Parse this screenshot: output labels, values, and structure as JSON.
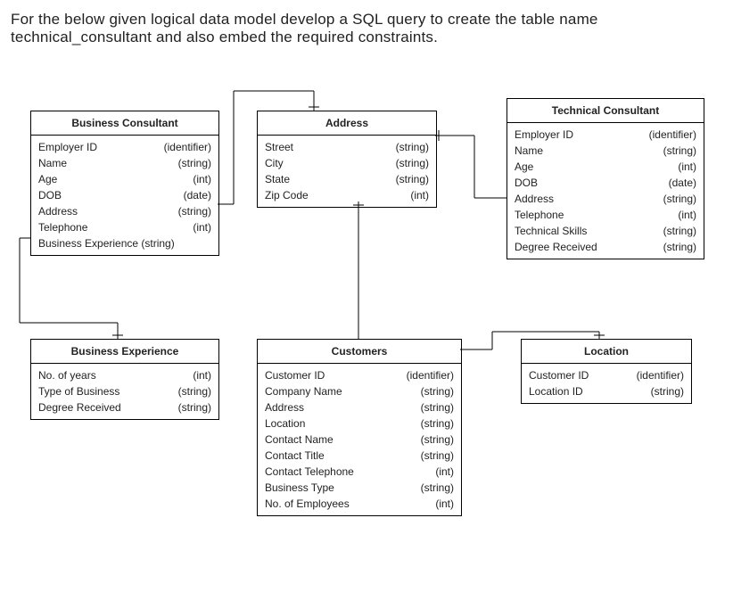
{
  "prompt_text": "For the below given logical data model develop a SQL query to create the table name technical_consultant and also embed the required constraints.",
  "entities": {
    "business_consultant": {
      "title": "Business Consultant",
      "attributes": [
        {
          "name": "Employer ID",
          "type": "(identifier)"
        },
        {
          "name": "Name",
          "type": "(string)"
        },
        {
          "name": "Age",
          "type": "(int)"
        },
        {
          "name": "DOB",
          "type": "(date)"
        },
        {
          "name": "Address",
          "type": "(string)"
        },
        {
          "name": "Telephone",
          "type": "(int)"
        },
        {
          "name": "Business Experience (string)",
          "type": ""
        }
      ]
    },
    "address": {
      "title": "Address",
      "attributes": [
        {
          "name": "Street",
          "type": "(string)"
        },
        {
          "name": "City",
          "type": "(string)"
        },
        {
          "name": "State",
          "type": "(string)"
        },
        {
          "name": "Zip Code",
          "type": "(int)"
        }
      ]
    },
    "technical_consultant": {
      "title": "Technical Consultant",
      "attributes": [
        {
          "name": "Employer ID",
          "type": "(identifier)"
        },
        {
          "name": "Name",
          "type": "(string)"
        },
        {
          "name": "Age",
          "type": "(int)"
        },
        {
          "name": "DOB",
          "type": "(date)"
        },
        {
          "name": "Address",
          "type": "(string)"
        },
        {
          "name": "Telephone",
          "type": "(int)"
        },
        {
          "name": "Technical Skills",
          "type": "(string)"
        },
        {
          "name": "Degree Received",
          "type": "(string)"
        }
      ]
    },
    "business_experience": {
      "title": "Business Experience",
      "attributes": [
        {
          "name": "No. of years",
          "type": "(int)"
        },
        {
          "name": "Type of Business",
          "type": "(string)"
        },
        {
          "name": "Degree Received",
          "type": "(string)"
        }
      ]
    },
    "customers": {
      "title": "Customers",
      "attributes": [
        {
          "name": "Customer ID",
          "type": "(identifier)"
        },
        {
          "name": "Company Name",
          "type": "(string)"
        },
        {
          "name": "Address",
          "type": "(string)"
        },
        {
          "name": "Location",
          "type": "(string)"
        },
        {
          "name": "Contact Name",
          "type": "(string)"
        },
        {
          "name": "Contact Title",
          "type": "(string)"
        },
        {
          "name": "Contact Telephone",
          "type": "(int)"
        },
        {
          "name": "Business Type",
          "type": "(string)"
        },
        {
          "name": "No. of Employees",
          "type": "(int)"
        }
      ]
    },
    "location": {
      "title": "Location",
      "attributes": [
        {
          "name": "Customer ID",
          "type": "(identifier)"
        },
        {
          "name": "Location ID",
          "type": "(string)"
        }
      ]
    }
  },
  "relationships": [
    {
      "from": "business_consultant.Address",
      "to": "address"
    },
    {
      "from": "technical_consultant.Address",
      "to": "address"
    },
    {
      "from": "customers.Address",
      "to": "address"
    },
    {
      "from": "business_consultant.Business Experience",
      "to": "business_experience"
    },
    {
      "from": "customers.Location",
      "to": "location"
    }
  ]
}
